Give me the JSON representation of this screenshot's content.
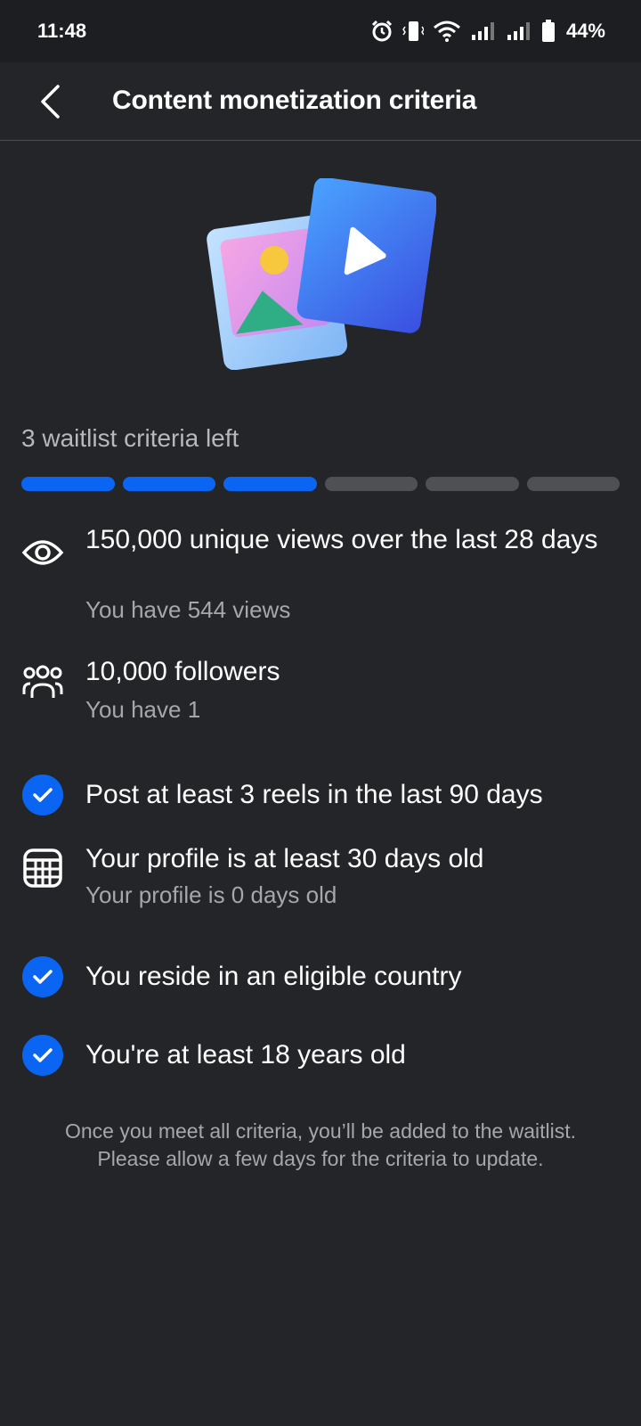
{
  "status": {
    "time": "11:48",
    "battery": "44%"
  },
  "header": {
    "title": "Content monetization criteria"
  },
  "progress": {
    "text": "3 waitlist criteria left",
    "segments_total": 6,
    "segments_done": 3
  },
  "criteria": [
    {
      "icon": "eye-icon",
      "title": "150,000 unique views over the last 28 days",
      "subtitle": "You have 544 views",
      "met": false
    },
    {
      "icon": "people-icon",
      "title": "10,000 followers",
      "subtitle": "You have 1",
      "met": false
    },
    {
      "icon": "check-circle-icon",
      "title": "Post at least 3 reels in the last 90 days",
      "subtitle": "",
      "met": true
    },
    {
      "icon": "calendar-icon",
      "title": "Your profile is at least 30 days old",
      "subtitle": "Your profile is 0 days old",
      "met": false
    },
    {
      "icon": "check-circle-icon",
      "title": "You reside in an eligible country",
      "subtitle": "",
      "met": true
    },
    {
      "icon": "check-circle-icon",
      "title": "You're at least 18 years old",
      "subtitle": "",
      "met": true
    }
  ],
  "footer": {
    "line1": "Once you meet all criteria, you’ll be added to the waitlist.",
    "line2": "Please allow a few days for the criteria to update."
  },
  "colors": {
    "background": "#242528",
    "accent": "#0a66f2",
    "muted_text": "#a4a7ac"
  }
}
